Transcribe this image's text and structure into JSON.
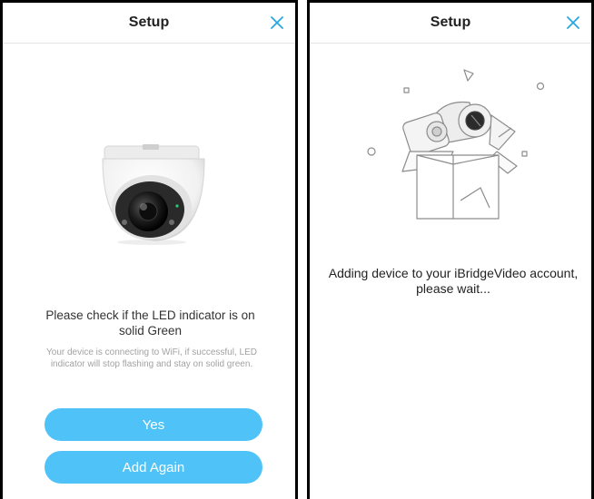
{
  "left_screen": {
    "title": "Setup",
    "close_glyph": "×",
    "message": "Please check if the LED indicator is on solid Green",
    "hint": "Your device is connecting to WiFi, if successful, LED indicator will stop flashing and stay on solid green.",
    "yes_label": "Yes",
    "add_again_label": "Add Again"
  },
  "right_screen": {
    "title": "Setup",
    "status_text": "Adding device to your iBridgeVideo account, please wait..."
  },
  "colors": {
    "accent": "#4fc3f7",
    "close_icon": "#29a8e0",
    "hint_text": "#a2a2a2"
  },
  "icons": [
    "close-icon",
    "dome-camera-image",
    "gift-box-illustration"
  ]
}
